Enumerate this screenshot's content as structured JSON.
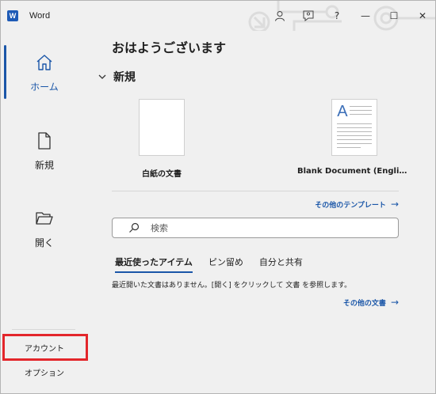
{
  "app": {
    "logo_letter": "W",
    "title": "Word"
  },
  "window_controls": {
    "help": "?",
    "minimize": "—",
    "maximize": "☐",
    "close": "✕"
  },
  "sidebar": {
    "items": [
      {
        "label": "ホーム",
        "icon": "home-icon",
        "active": true
      },
      {
        "label": "新規",
        "icon": "new-document-icon",
        "active": false
      },
      {
        "label": "開く",
        "icon": "open-folder-icon",
        "active": false
      }
    ],
    "bottom": [
      {
        "label": "アカウント",
        "highlighted": true
      },
      {
        "label": "オプション",
        "highlighted": false
      }
    ]
  },
  "main": {
    "greeting": "おはようございます",
    "new_section": {
      "title": "新規",
      "templates": [
        {
          "label": "白紙の文書",
          "thumb": "blank"
        },
        {
          "label": "Blank Document (Engli…",
          "thumb": "letter-A"
        }
      ]
    },
    "more_templates": "その他のテンプレート",
    "search": {
      "placeholder": "検索"
    },
    "tabs": [
      {
        "label": "最近使ったアイテム",
        "active": true
      },
      {
        "label": "ピン留め",
        "active": false
      },
      {
        "label": "自分と共有",
        "active": false
      }
    ],
    "empty_message": "最近開いた文書はありません。[開く] をクリックして 文書 を参照します。",
    "more_documents": "その他の文書",
    "arrow": "→"
  },
  "colors": {
    "accent": "#1a56a8",
    "highlight_border": "#e3262b",
    "word_blue": "#1f5bb6"
  }
}
